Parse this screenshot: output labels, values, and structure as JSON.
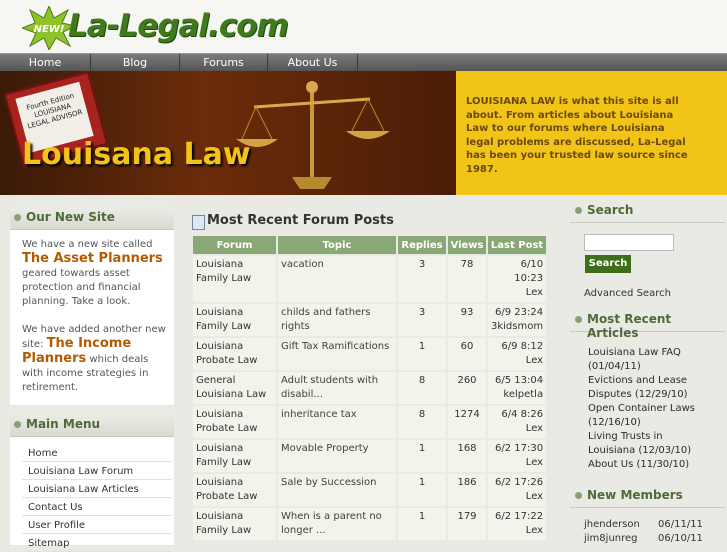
{
  "logo": {
    "badge": "NEW!",
    "text": "La-Legal.com"
  },
  "nav": [
    "Home",
    "Blog",
    "Forums",
    "About Us"
  ],
  "banner": {
    "title": "Louisana Law",
    "book_text": "Fourth Edition LOUISIANA LEGAL ADVISOR",
    "description": "LOUISIANA LAW is what this site is all about. From articles about Louisiana Law to our forums where Louisiana legal problems are discussed, La-Legal has been your trusted law source since 1987."
  },
  "left": {
    "site_title": "Our New Site",
    "p1_before": "We have a new site called",
    "p1_link": "The Asset Planners",
    "p1_after": "geared towards asset protection and financial planning. Take a look.",
    "p2_before": "We have added another new site:",
    "p2_link": "The Income Planners",
    "p2_after": "which deals with income strategies in retirement.",
    "menu_title": "Main Menu",
    "menu": [
      "Home",
      "Louisiana Law Forum",
      "Louisiana Law Articles",
      "Contact Us",
      "User Profile",
      "Sitemap"
    ]
  },
  "posts": {
    "title": "Most Recent Forum Posts",
    "headers": [
      "Forum",
      "Topic",
      "Replies",
      "Views",
      "Last Post"
    ],
    "rows": [
      {
        "forum": "Louisiana Family Law",
        "topic": "vacation",
        "replies": "3",
        "views": "78",
        "date": "6/10 10:23",
        "user": "Lex"
      },
      {
        "forum": "Louisiana Family Law",
        "topic": "childs and fathers rights",
        "replies": "3",
        "views": "93",
        "date": "6/9 23:24",
        "user": "3kidsmom"
      },
      {
        "forum": "Louisiana Probate Law",
        "topic": "Gift Tax Ramifications",
        "replies": "1",
        "views": "60",
        "date": "6/9 8:12",
        "user": "Lex"
      },
      {
        "forum": "General Louisiana Law",
        "topic": "Adult students with disabil...",
        "replies": "8",
        "views": "260",
        "date": "6/5 13:04",
        "user": "kelpetla"
      },
      {
        "forum": "Louisiana Probate Law",
        "topic": "inheritance tax",
        "replies": "8",
        "views": "1274",
        "date": "6/4 8:26",
        "user": "Lex"
      },
      {
        "forum": "Louisiana Family Law",
        "topic": "Movable Property",
        "replies": "1",
        "views": "168",
        "date": "6/2 17:30",
        "user": "Lex"
      },
      {
        "forum": "Louisiana Probate Law",
        "topic": "Sale by Succession",
        "replies": "1",
        "views": "186",
        "date": "6/2 17:26",
        "user": "Lex"
      },
      {
        "forum": "Louisiana Family Law",
        "topic": "When is a parent no longer ...",
        "replies": "1",
        "views": "179",
        "date": "6/2 17:22",
        "user": "Lex"
      }
    ]
  },
  "right": {
    "search_title": "Search",
    "search_button": "Search",
    "search_value": "",
    "advanced": "Advanced Search",
    "articles_title": "Most Recent Articles",
    "articles": [
      "Louisiana Law FAQ (01/04/11)",
      "Evictions and Lease Disputes (12/29/10)",
      "Open Container Laws (12/16/10)",
      "Living Trusts in Louisiana (12/03/10)",
      "About Us (11/30/10)"
    ],
    "members_title": "New Members",
    "members": [
      {
        "name": "jhenderson",
        "date": "06/11/11"
      },
      {
        "name": "jim8junreg",
        "date": "06/10/11"
      }
    ]
  }
}
